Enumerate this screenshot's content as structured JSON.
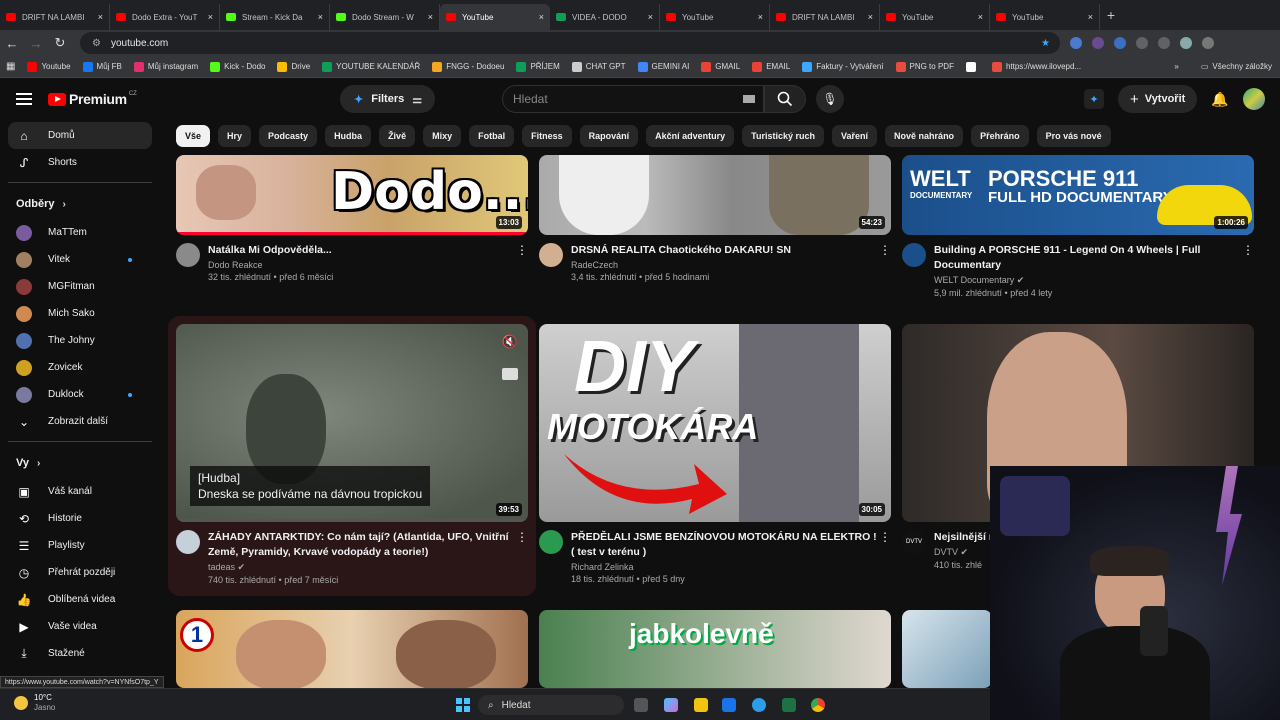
{
  "tabs": [
    {
      "title": "DRIFT NA LAMBI",
      "color": "#ff0000",
      "active": false
    },
    {
      "title": "Dodo Extra - YouT",
      "color": "#ff0000",
      "active": false
    },
    {
      "title": "Stream - Kick Da",
      "color": "#53fc18",
      "active": false
    },
    {
      "title": "Dodo Stream - W",
      "color": "#53fc18",
      "active": false
    },
    {
      "title": "YouTube",
      "color": "#ff0000",
      "active": true
    },
    {
      "title": "VIDEA - DODO",
      "color": "#0f9d58",
      "active": false
    },
    {
      "title": "YouTube",
      "color": "#ff0000",
      "active": false
    },
    {
      "title": "DRIFT NA LAMBI",
      "color": "#ff0000",
      "active": false
    },
    {
      "title": "YouTube",
      "color": "#ff0000",
      "active": false
    },
    {
      "title": "YouTube",
      "color": "#ff0000",
      "active": false
    }
  ],
  "new_tab": "+",
  "address": {
    "url": "youtube.com"
  },
  "bookmarks": [
    {
      "label": "Youtube",
      "color": "#ff0000"
    },
    {
      "label": "Můj FB",
      "color": "#1877f2"
    },
    {
      "label": "Můj instagram",
      "color": "#e1306c"
    },
    {
      "label": "Kick - Dodo",
      "color": "#53fc18"
    },
    {
      "label": "Drive",
      "color": "#fbbc04"
    },
    {
      "label": "YOUTUBE KALENDÁŘ",
      "color": "#0f9d58"
    },
    {
      "label": "FNGG - Dodoeu",
      "color": "#f5a623"
    },
    {
      "label": "PŘÍJEM",
      "color": "#0f9d58"
    },
    {
      "label": "CHAT GPT",
      "color": "#cccccc"
    },
    {
      "label": "GEMINI AI",
      "color": "#4285f4"
    },
    {
      "label": "GMAIL",
      "color": "#ea4335"
    },
    {
      "label": "EMAIL",
      "color": "#ea4335"
    },
    {
      "label": "Faktury - Vytváření",
      "color": "#3ea6ff"
    },
    {
      "label": "PNG to PDF",
      "color": "#e74c3c"
    },
    {
      "label": "",
      "color": "#ffffff"
    },
    {
      "label": "https://www.ilovepd...",
      "color": "#e74c3c"
    }
  ],
  "bookmarks_more": "»",
  "bookmarks_all": "Všechny záložky",
  "logo": {
    "text": "Premium",
    "region": "CZ"
  },
  "filters_label": "Filters",
  "search": {
    "placeholder": "Hledat"
  },
  "create_label": "Vytvořit",
  "chips": [
    "Vše",
    "Hry",
    "Podcasty",
    "Hudba",
    "Živě",
    "Mixy",
    "Fotbal",
    "Fitness",
    "Rapování",
    "Akční adventury",
    "Turistický ruch",
    "Vaření",
    "Nově nahráno",
    "Přehráno",
    "Pro vás nové"
  ],
  "sidebar": {
    "home": "Domů",
    "shorts": "Shorts",
    "subs_header": "Odběry",
    "subs": [
      {
        "name": "MaTTem",
        "color": "#7a5c9e",
        "dot": false
      },
      {
        "name": "Vitek",
        "color": "#a08060",
        "dot": true
      },
      {
        "name": "MGFitman",
        "color": "#8b3a3a",
        "dot": false
      },
      {
        "name": "Mich Sako",
        "color": "#d08a50",
        "dot": false
      },
      {
        "name": "The Johny",
        "color": "#5070b0",
        "dot": false
      },
      {
        "name": "Zovicek",
        "color": "#d0a020",
        "dot": false
      },
      {
        "name": "Duklock",
        "color": "#7a7aa0",
        "dot": true
      }
    ],
    "show_more": "Zobrazit další",
    "you_header": "Vy",
    "you": [
      {
        "label": "Váš kanál",
        "icon": "channel-icon"
      },
      {
        "label": "Historie",
        "icon": "history-icon"
      },
      {
        "label": "Playlisty",
        "icon": "playlists-icon"
      },
      {
        "label": "Přehrát později",
        "icon": "watch-later-icon"
      },
      {
        "label": "Oblíbená videa",
        "icon": "like-icon"
      },
      {
        "label": "Vaše videa",
        "icon": "your-videos-icon"
      },
      {
        "label": "Stažené",
        "icon": "downloads-icon"
      }
    ]
  },
  "videos": [
    {
      "title": "Natálka Mi Odpověděla...",
      "channel": "Dodo Reakce",
      "stats": "32 tis. zhlédnutí • před 6 měsíci",
      "duration": "13:03",
      "thumb_text": "Dodo...",
      "verified": false
    },
    {
      "title": "DRSNÁ REALITA Chaotického DAKARU! SN",
      "channel": "RadeCzech",
      "stats": "3,4 tis. zhlédnutí • před 5 hodinami",
      "duration": "54:23",
      "verified": false
    },
    {
      "title": "Building A PORSCHE 911 - Legend On 4 Wheels | Full Documentary",
      "channel": "WELT Documentary",
      "stats": "5,9 mil. zhlédnutí • před 4 lety",
      "duration": "1:00:26",
      "thumb_l1": "WELT",
      "thumb_l1b": "DOCUMENTARY",
      "thumb_l2": "PORSCHE 911",
      "thumb_l3": "FULL HD DOCUMENTARY",
      "verified": true
    },
    {
      "title": "ZÁHADY ANTARKTIDY: Co nám tají? (Atlantida, UFO, Vnitřní Země, Pyramidy, Krvavé vodopády a teorie!)",
      "channel": "tadeas",
      "stats": "740 tis. zhlédnutí • před 7 měsíci",
      "duration": "39:53",
      "caption1": "[Hudba]",
      "caption2": "Dneska se podíváme na dávnou tropickou",
      "verified": true
    },
    {
      "title": "PŘEDĚLALI JSME BENZÍNOVOU MOTOKÁRU NA ELEKTRO ! ( test v terénu )",
      "channel": "Richard Zelinka",
      "stats": "18 tis. zhlédnutí • před 5 dny",
      "duration": "30:05",
      "thumb_l1": "DIY",
      "thumb_l2": "MOTOKÁRA",
      "verified": false
    },
    {
      "title": "Nejsilnější m kosti, udělal",
      "channel": "DVTV",
      "stats": "410 tis. zhlé",
      "duration": "",
      "channel_badge": "DVTV",
      "verified": true
    },
    {
      "title": "",
      "channel": "",
      "stats": "",
      "duration": "",
      "thumb_badge": "1"
    },
    {
      "title": "",
      "channel": "",
      "stats": "",
      "duration": "",
      "thumb_text": "jabkolevně"
    },
    {
      "title": "",
      "channel": "",
      "stats": "",
      "duration": ""
    }
  ],
  "statusbar_url": "https://www.youtube.com/watch?v=NYNfsO7tp_Y",
  "taskbar": {
    "temp": "10°C",
    "weather": "Jasno",
    "search": "Hledat"
  }
}
